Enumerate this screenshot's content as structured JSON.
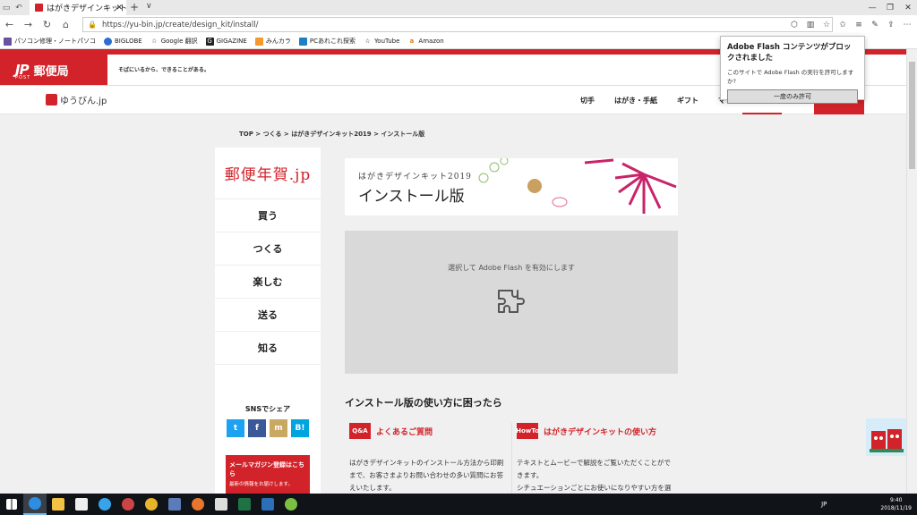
{
  "browser": {
    "tab_title": "はがきデザインキット2019 |",
    "url": "https://yu-bin.jp/create/design_kit/install/",
    "bookmarks": [
      "パソコン修理・ノートパソコ",
      "BIGLOBE",
      "Google 翻訳",
      "GIGAZINE",
      "みんカラ",
      "PCあれこれ探索",
      "YouTube",
      "Amazon"
    ]
  },
  "header": {
    "logo_mark": "JP",
    "logo_name": "郵便局",
    "logo_sub": "POST",
    "slogan": "そばにいるから、できることがある。"
  },
  "sitenav": {
    "site_name": "ゆうびん.jp",
    "menu": [
      "切手",
      "はがき・手紙",
      "ギフト",
      "マ"
    ]
  },
  "breadcrumb": "TOP > つくる > はがきデザインキット2019 > インストール版",
  "sidebar": {
    "logo": "郵便年賀.jp",
    "items": [
      "買う",
      "つくる",
      "楽しむ",
      "送る",
      "知る"
    ],
    "sns_title": "SNSでシェア",
    "sns": [
      "t",
      "f",
      "m",
      "B!"
    ],
    "mail_title": "メールマガジン登録はこちら",
    "mail_sub": "最新の情報をお届けします。"
  },
  "banner": {
    "subtitle": "はがきデザインキット2019",
    "title": "インストール版"
  },
  "flash": {
    "message": "選択して Adobe Flash を有効にします"
  },
  "help": {
    "title": "インストール版の使い方に困ったら",
    "cards": [
      {
        "badge": "Q&A",
        "title": "よくあるご質問",
        "text1": "はがきデザインキットのインストール方法から印刷",
        "text2": "まで、お客さまよりお問い合わせの多い質問にお答",
        "text3": "えいたします。"
      },
      {
        "badge": "HowTo",
        "title": "はがきデザインキットの使い方",
        "text1": "テキストとムービーで解説をご覧いただくことがで",
        "text2": "きます。",
        "text3": "シチュエーションごとにお使いになりやすい方を選"
      }
    ]
  },
  "popup": {
    "title": "Adobe Flash コンテンツがブロックされました",
    "message": "このサイトで Adobe Flash の実行を許可しますか?",
    "button": "一度のみ許可"
  },
  "taskbar": {
    "lang": "JP",
    "time": "9:40",
    "date": "2018/11/19"
  },
  "colors": {
    "brand_red": "#d2232a"
  }
}
